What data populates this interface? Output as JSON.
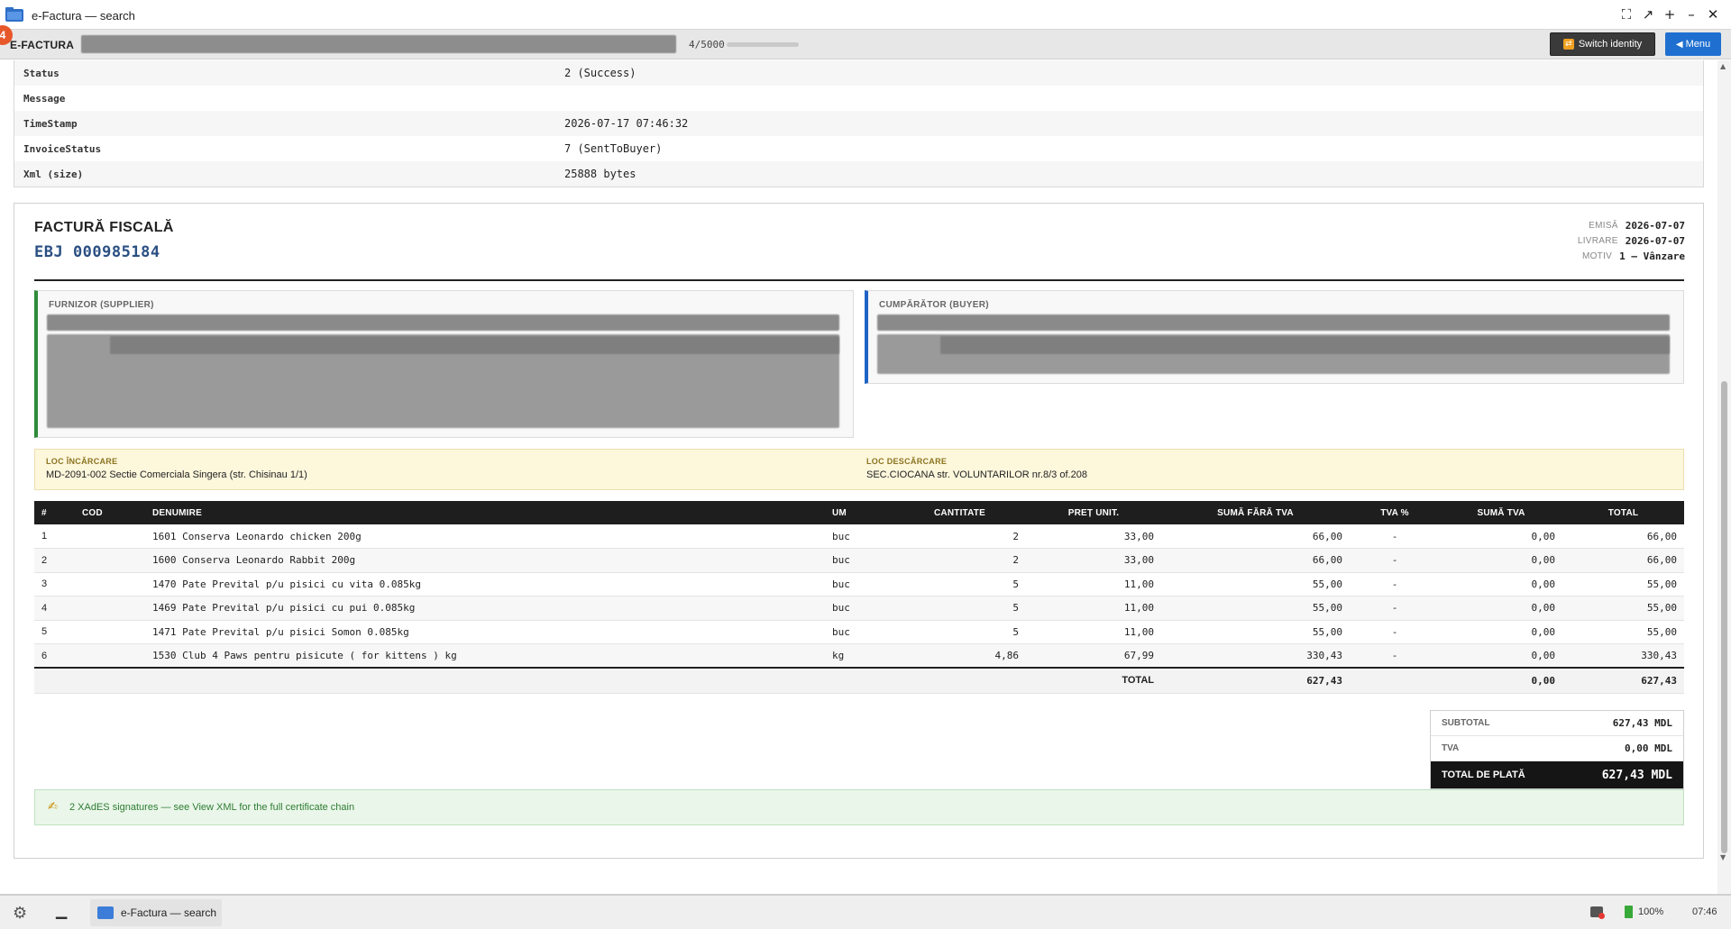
{
  "window": {
    "title": "e-Factura — search"
  },
  "appbar": {
    "notification_count": "4",
    "brand": "E-FACTURA",
    "counter": "4/5000",
    "progress_fraction": 0.0008,
    "switch_identity_label": "Switch identity",
    "menu_label": "Menu"
  },
  "meta": {
    "rows": [
      {
        "key": "Status",
        "value": "2 (Success)"
      },
      {
        "key": "Message",
        "value": ""
      },
      {
        "key": "TimeStamp",
        "value": "2026-07-17 07:46:32"
      },
      {
        "key": "InvoiceStatus",
        "value": "7 (SentToBuyer)"
      },
      {
        "key": "Xml (size)",
        "value": "25888 bytes"
      }
    ]
  },
  "invoice": {
    "title": "FACTURĂ FISCALĂ",
    "number": "EBJ 000985184",
    "dates": {
      "issued_label": "EMISĂ",
      "issued": "2026-07-07",
      "delivery_label": "LIVRARE",
      "delivery": "2026-07-07",
      "reason_label": "MOTIV",
      "reason": "1 — Vânzare"
    },
    "supplier_label": "FURNIZOR (SUPPLIER)",
    "buyer_label": "CUMPĂRĂTOR (BUYER)",
    "loading_label": "LOC ÎNCĂRCARE",
    "loading_value": "MD-2091-002 Sectie Comerciala Singera (str. Chisinau 1/1)",
    "unloading_label": "LOC DESCĂRCARE",
    "unloading_value": "SEC.CIOCANA str. VOLUNTARILOR nr.8/3 of.208",
    "columns": [
      "#",
      "COD",
      "DENUMIRE",
      "UM",
      "CANTITATE",
      "PREȚ UNIT.",
      "SUMĂ FĂRĂ TVA",
      "TVA %",
      "SUMĂ TVA",
      "TOTAL"
    ],
    "items": [
      {
        "n": "1",
        "cod": "",
        "name": "1601 Conserva Leonardo chicken 200g",
        "um": "buc",
        "qty": "2",
        "price": "33,00",
        "net": "66,00",
        "vat_pct": "-",
        "vat": "0,00",
        "total": "66,00"
      },
      {
        "n": "2",
        "cod": "",
        "name": "1600 Conserva Leonardo Rabbit 200g",
        "um": "buc",
        "qty": "2",
        "price": "33,00",
        "net": "66,00",
        "vat_pct": "-",
        "vat": "0,00",
        "total": "66,00"
      },
      {
        "n": "3",
        "cod": "",
        "name": "1470 Pate Prevital p/u pisici cu vita 0.085kg",
        "um": "buc",
        "qty": "5",
        "price": "11,00",
        "net": "55,00",
        "vat_pct": "-",
        "vat": "0,00",
        "total": "55,00"
      },
      {
        "n": "4",
        "cod": "",
        "name": "1469 Pate Prevital p/u pisici cu pui 0.085kg",
        "um": "buc",
        "qty": "5",
        "price": "11,00",
        "net": "55,00",
        "vat_pct": "-",
        "vat": "0,00",
        "total": "55,00"
      },
      {
        "n": "5",
        "cod": "",
        "name": "1471 Pate Prevital p/u pisici Somon 0.085kg",
        "um": "buc",
        "qty": "5",
        "price": "11,00",
        "net": "55,00",
        "vat_pct": "-",
        "vat": "0,00",
        "total": "55,00"
      },
      {
        "n": "6",
        "cod": "",
        "name": "1530 Club 4 Paws pentru pisicute ( for kittens ) kg",
        "um": "kg",
        "qty": "4,86",
        "price": "67,99",
        "net": "330,43",
        "vat_pct": "-",
        "vat": "0,00",
        "total": "330,43"
      }
    ],
    "footer": {
      "label": "TOTAL",
      "net": "627,43",
      "vat": "0,00",
      "total": "627,43"
    },
    "totals": {
      "subtotal_label": "SUBTOTAL",
      "subtotal": "627,43 MDL",
      "vat_label": "TVA",
      "vat": "0,00 MDL",
      "grand_label": "TOTAL DE PLATĂ",
      "grand": "627,43 MDL"
    },
    "signature_text": "2 XAdES signatures — see View XML for the full certificate chain"
  },
  "taskbar": {
    "task_label": "e-Factura — search",
    "battery": "100%",
    "clock": "07:46"
  }
}
